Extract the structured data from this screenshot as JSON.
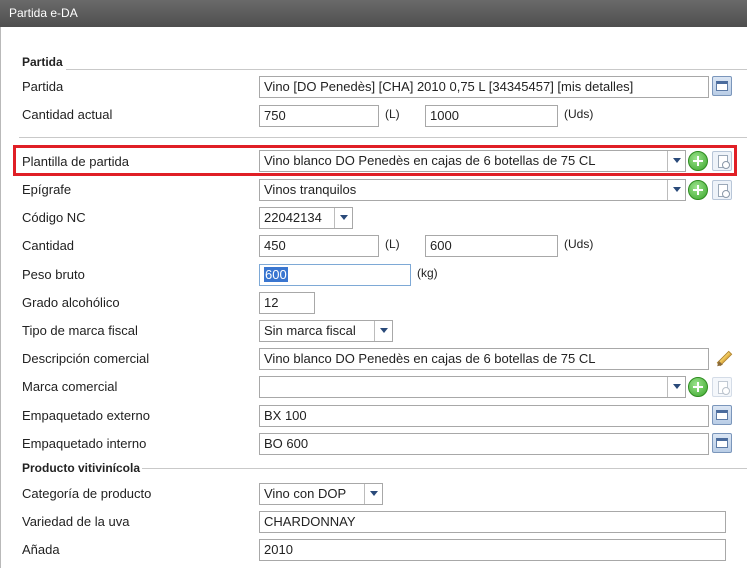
{
  "window": {
    "title": "Partida e-DA"
  },
  "partida_section": {
    "title": "Partida",
    "partida": {
      "label": "Partida",
      "value": "Vino [DO Penedès] [CHA] 2010 0,75 L [34345457] [mis detalles]"
    },
    "cantidad_actual": {
      "label": "Cantidad actual",
      "litros": "750",
      "litros_unit": "(L)",
      "unidades": "1000",
      "unidades_unit": "(Uds)"
    }
  },
  "form": {
    "plantilla": {
      "label": "Plantilla de partida",
      "value": "Vino blanco DO Penedès en cajas de 6 botellas de 75 CL"
    },
    "epigrafe": {
      "label": "Epígrafe",
      "value": "Vinos tranquilos"
    },
    "codigo_nc": {
      "label": "Código NC",
      "value": "22042134"
    },
    "cantidad": {
      "label": "Cantidad",
      "litros": "450",
      "litros_unit": "(L)",
      "unidades": "600",
      "unidades_unit": "(Uds)"
    },
    "peso_bruto": {
      "label": "Peso bruto",
      "value": "600",
      "unit": "(kg)"
    },
    "grado": {
      "label": "Grado alcohólico",
      "value": "12"
    },
    "tipo_marca": {
      "label": "Tipo de marca fiscal",
      "value": "Sin marca fiscal"
    },
    "descripcion": {
      "label": "Descripción comercial",
      "value": "Vino blanco DO Penedès en cajas de 6 botellas de 75 CL"
    },
    "marca_comercial": {
      "label": "Marca comercial",
      "value": ""
    },
    "emp_externo": {
      "label": "Empaquetado externo",
      "value": "BX 100"
    },
    "emp_interno": {
      "label": "Empaquetado interno",
      "value": "BO 600"
    }
  },
  "producto_section": {
    "title": "Producto vitivinícola",
    "categoria": {
      "label": "Categoría de producto",
      "value": "Vino con DOP"
    },
    "variedad": {
      "label": "Variedad de la uva",
      "value": "CHARDONNAY"
    },
    "anada": {
      "label": "Añada",
      "value": "2010"
    }
  }
}
